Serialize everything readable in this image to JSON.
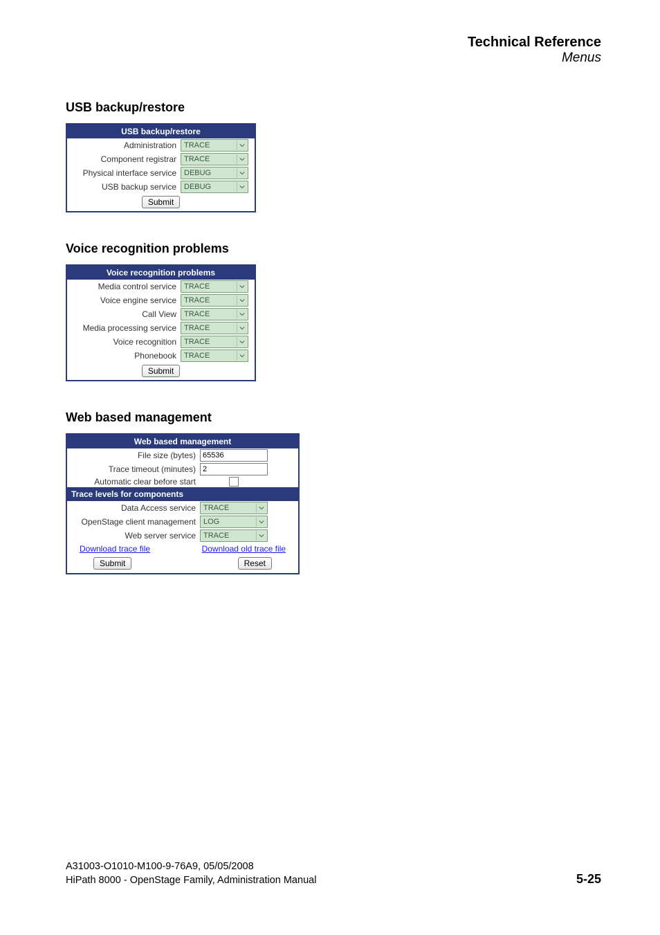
{
  "header": {
    "title": "Technical Reference",
    "subtitle": "Menus"
  },
  "usb": {
    "heading": "USB backup/restore",
    "panel_title": "USB backup/restore",
    "rows": [
      {
        "label": "Administration",
        "value": "TRACE"
      },
      {
        "label": "Component registrar",
        "value": "TRACE"
      },
      {
        "label": "Physical interface service",
        "value": "DEBUG"
      },
      {
        "label": "USB backup service",
        "value": "DEBUG"
      }
    ],
    "submit": "Submit"
  },
  "voice": {
    "heading": "Voice recognition problems",
    "panel_title": "Voice recognition problems",
    "rows": [
      {
        "label": "Media control service",
        "value": "TRACE"
      },
      {
        "label": "Voice engine service",
        "value": "TRACE"
      },
      {
        "label": "Call View",
        "value": "TRACE"
      },
      {
        "label": "Media processing service",
        "value": "TRACE"
      },
      {
        "label": "Voice recognition",
        "value": "TRACE"
      },
      {
        "label": "Phonebook",
        "value": "TRACE"
      }
    ],
    "submit": "Submit"
  },
  "web": {
    "heading": "Web based management",
    "panel_title": "Web based management",
    "filesize_label": "File size (bytes)",
    "filesize_value": "65536",
    "timeout_label": "Trace timeout (minutes)",
    "timeout_value": "2",
    "autoclear_label": "Automatic clear before start",
    "subhead": "Trace levels for components",
    "rows": [
      {
        "label": "Data Access service",
        "value": "TRACE"
      },
      {
        "label": "OpenStage client management",
        "value": "LOG"
      },
      {
        "label": "Web server service",
        "value": "TRACE"
      }
    ],
    "link1": "Download trace file",
    "link2": "Download old trace file",
    "submit": "Submit",
    "reset": "Reset"
  },
  "footer": {
    "line1": "A31003-O1010-M100-9-76A9, 05/05/2008",
    "line2": "HiPath 8000 - OpenStage Family, Administration Manual",
    "page": "5-25"
  }
}
